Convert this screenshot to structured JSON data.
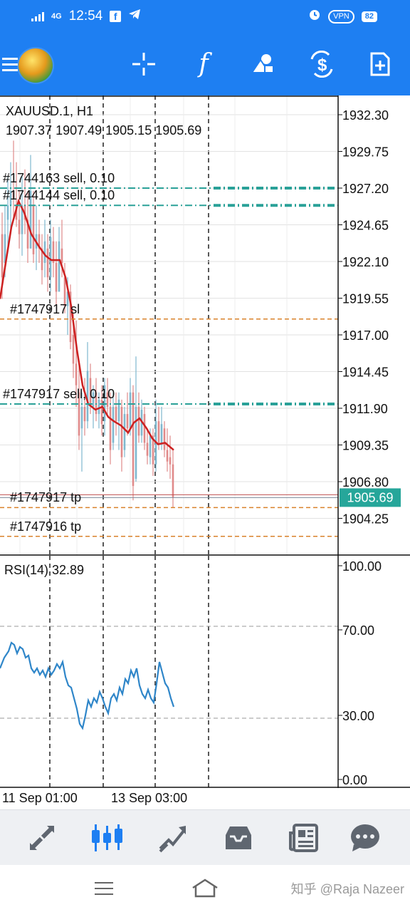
{
  "status_bar": {
    "network": "4G",
    "time": "12:54",
    "vpn": "VPN",
    "battery": "82"
  },
  "toolbar": {
    "icons": [
      "menu-icon",
      "app-logo-icon",
      "crosshair-icon",
      "indicators-icon",
      "objects-icon",
      "trade-icon",
      "new-order-icon"
    ],
    "accent": "#1e7ff2"
  },
  "chart": {
    "symbol_timeframe": "XAUUSD.1, H1",
    "ohlc": "1907.37 1907.49 1905.15 1905.69",
    "current_price": "1905.69",
    "current_price_color": "#26a69a",
    "price_ticks": [
      "1932.30",
      "1929.75",
      "1927.20",
      "1924.65",
      "1922.10",
      "1919.55",
      "1917.00",
      "1914.45",
      "1911.90",
      "1909.35",
      "1906.80",
      "1904.25"
    ],
    "orders": [
      {
        "label": "#1744163 sell, 0.10",
        "price": 1927.2,
        "type": "sell",
        "color": "#2aa198"
      },
      {
        "label": "#1744144 sell, 0.10",
        "price": 1926.0,
        "type": "sell",
        "color": "#2aa198"
      },
      {
        "label": "#1747917 sl",
        "price": 1918.1,
        "type": "sl",
        "color": "#d9822b"
      },
      {
        "label": "#1747917 sell, 0.10",
        "price": 1912.2,
        "type": "sell",
        "color": "#2aa198"
      },
      {
        "label": "#1747917 tp",
        "price": 1905.0,
        "type": "tp",
        "color": "#d9822b"
      },
      {
        "label": "#1747916 tp",
        "price": 1903.0,
        "type": "tp",
        "color": "#d9822b"
      }
    ]
  },
  "rsi": {
    "label": "RSI(14) 32.89",
    "ticks": [
      "100.00",
      "70.00",
      "30.00",
      "0.00"
    ],
    "line_color": "#2f86c9"
  },
  "time_axis": {
    "labels": [
      "11 Sep 01:00",
      "13 Sep 03:00"
    ]
  },
  "bottom_nav": {
    "icons": [
      "quotes-icon",
      "chart-icon",
      "trade-icon",
      "history-icon",
      "news-icon",
      "messages-icon"
    ],
    "active_index": 1
  },
  "watermark": "知乎 @Raja Nazeer"
}
